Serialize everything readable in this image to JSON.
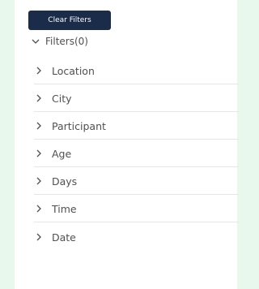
{
  "toolbar": {
    "clear_filters_label": "Clear Filters"
  },
  "filters": {
    "header_label": "Filters(0)",
    "items": [
      {
        "label": "Location"
      },
      {
        "label": "City"
      },
      {
        "label": "Participant"
      },
      {
        "label": "Age"
      },
      {
        "label": "Days"
      },
      {
        "label": "Time"
      },
      {
        "label": "Date"
      }
    ]
  },
  "colors": {
    "page_bg": "#e8f8ec",
    "panel_bg": "#ffffff",
    "button_bg": "#1b2b4a",
    "button_text": "#ffffff",
    "text": "#505050",
    "divider": "#e6e6e6"
  }
}
